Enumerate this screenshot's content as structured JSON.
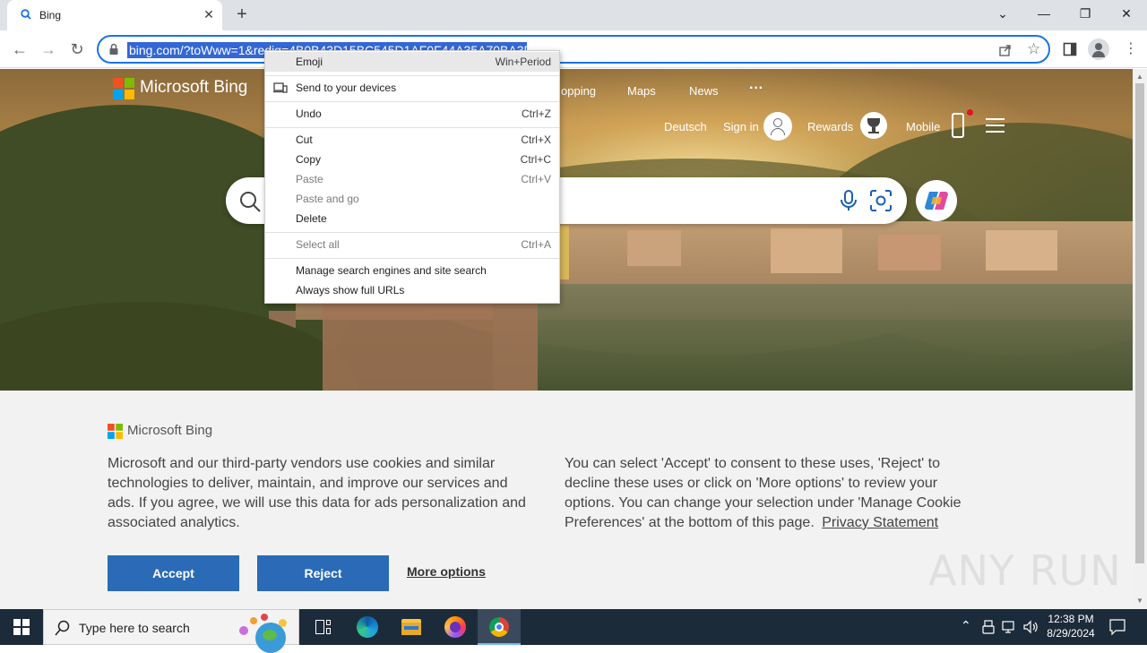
{
  "browser": {
    "tab_title": "Bing",
    "url": "bing.com/?toWww=1&redig=4B0B43D15BC545D1AF0F44A35A70BA3D"
  },
  "bing": {
    "brand": "Microsoft Bing",
    "nav_partial": "opping",
    "nav_maps": "Maps",
    "nav_news": "News",
    "nav_more": "···",
    "lang": "Deutsch",
    "signin": "Sign in",
    "rewards": "Rewards",
    "mobile": "Mobile"
  },
  "context_menu": {
    "items": [
      {
        "label": "Emoji",
        "shortcut": "Win+Period",
        "disabled": false
      },
      {
        "label": "Send to your devices",
        "shortcut": "",
        "disabled": false
      },
      {
        "label": "Undo",
        "shortcut": "Ctrl+Z",
        "disabled": false
      },
      {
        "label": "Cut",
        "shortcut": "Ctrl+X",
        "disabled": false
      },
      {
        "label": "Copy",
        "shortcut": "Ctrl+C",
        "disabled": false
      },
      {
        "label": "Paste",
        "shortcut": "Ctrl+V",
        "disabled": true
      },
      {
        "label": "Paste and go",
        "shortcut": "",
        "disabled": true
      },
      {
        "label": "Delete",
        "shortcut": "",
        "disabled": false
      },
      {
        "label": "Select all",
        "shortcut": "Ctrl+A",
        "disabled": true
      },
      {
        "label": "Manage search engines and site search",
        "shortcut": "",
        "disabled": false
      },
      {
        "label": "Always show full URLs",
        "shortcut": "",
        "disabled": false
      }
    ]
  },
  "cookie": {
    "brand": "Microsoft Bing",
    "left_text": "Microsoft and our third-party vendors use cookies and similar technologies to deliver, maintain, and improve our services and ads. If you agree, we will use this data for ads personalization and associated analytics.",
    "right_text": "You can select 'Accept' to consent to these uses, 'Reject' to decline these uses or click on 'More options' to review your options. You can change your selection under 'Manage Cookie Preferences' at the bottom of this page.",
    "privacy_link": "Privacy Statement",
    "accept": "Accept",
    "reject": "Reject",
    "more_options": "More options"
  },
  "watermark": "ANY RUN",
  "taskbar": {
    "search_placeholder": "Type here to search",
    "time": "12:38 PM",
    "date": "8/29/2024"
  }
}
